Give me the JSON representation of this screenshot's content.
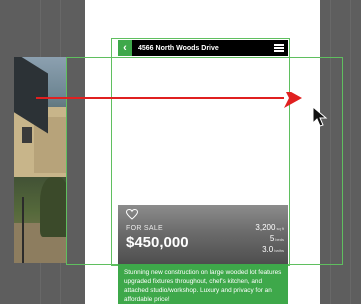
{
  "navbar": {
    "back_label": "‹",
    "address": "4566 North Woods Drive"
  },
  "listing": {
    "status": "FOR SALE",
    "price": "$450,000",
    "stats": [
      {
        "value": "3,200",
        "unit": "sq ft"
      },
      {
        "value": "5",
        "unit": "beds"
      },
      {
        "value": "3.0",
        "unit": "baths"
      }
    ],
    "description": "Stunning new construction on large wooded lot features upgraded fixtures throughout, chef's kitchen, and attached studio/workshop. Luxury and privacy for an affordable price!"
  },
  "colors": {
    "accent_green": "#3ea84a",
    "drag_arrow": "#e02020",
    "guide": "#5fbf5f"
  },
  "icons": [
    "back-chevron-icon",
    "hamburger-menu-icon",
    "heart-icon",
    "mouse-cursor-icon",
    "drag-arrow-icon"
  ]
}
